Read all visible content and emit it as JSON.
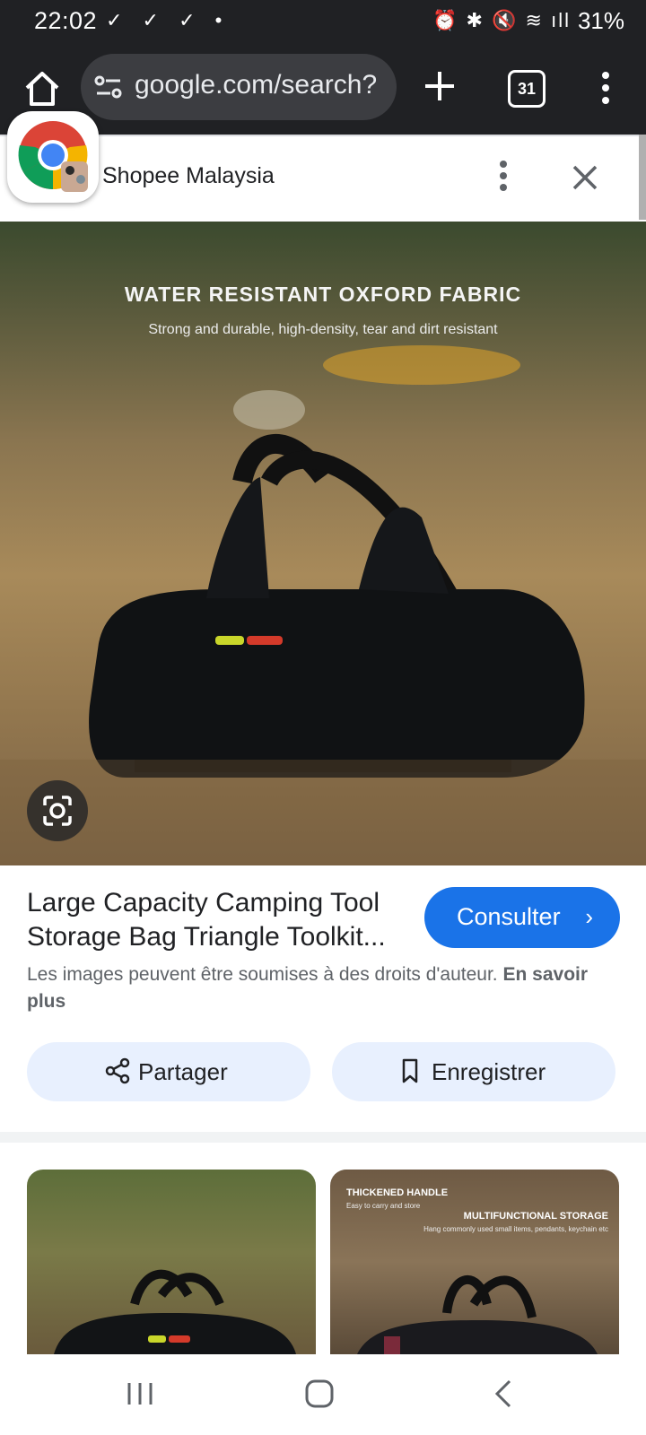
{
  "status_bar": {
    "time": "22:02",
    "notification_icons": "✓ ✓ ✓ •",
    "system_icons": "⏰ ✱ 🔇 ≋ ıll",
    "battery": "31%"
  },
  "toolbar": {
    "url": "google.com/search?",
    "tab_count": "31"
  },
  "panel": {
    "source_name": "Shopee Malaysia"
  },
  "image": {
    "overlay_title": "WATER RESISTANT OXFORD FABRIC",
    "overlay_subtitle": "Strong and durable, high-density, tear and dirt resistant"
  },
  "result": {
    "title": "Large Capacity Camping Tool Storage Bag Triangle Toolkit...",
    "visit_button": "Consulter",
    "rights_text": "Les images peuvent être soumises à des droits d'auteur.",
    "learn_more": "En savoir plus"
  },
  "actions": {
    "share": "Partager",
    "save": "Enregistrer"
  },
  "related": {
    "thumb2_title_left": "THICKENED HANDLE",
    "thumb2_sub_left": "Easy to carry and store",
    "thumb2_title_right": "MULTIFUNCTIONAL STORAGE",
    "thumb2_sub_right": "Hang commonly used small items, pendants, keychain etc"
  },
  "colors": {
    "toolbar_bg": "#202124",
    "accent_blue": "#1a73e8",
    "action_bg": "#e8f0fe"
  }
}
